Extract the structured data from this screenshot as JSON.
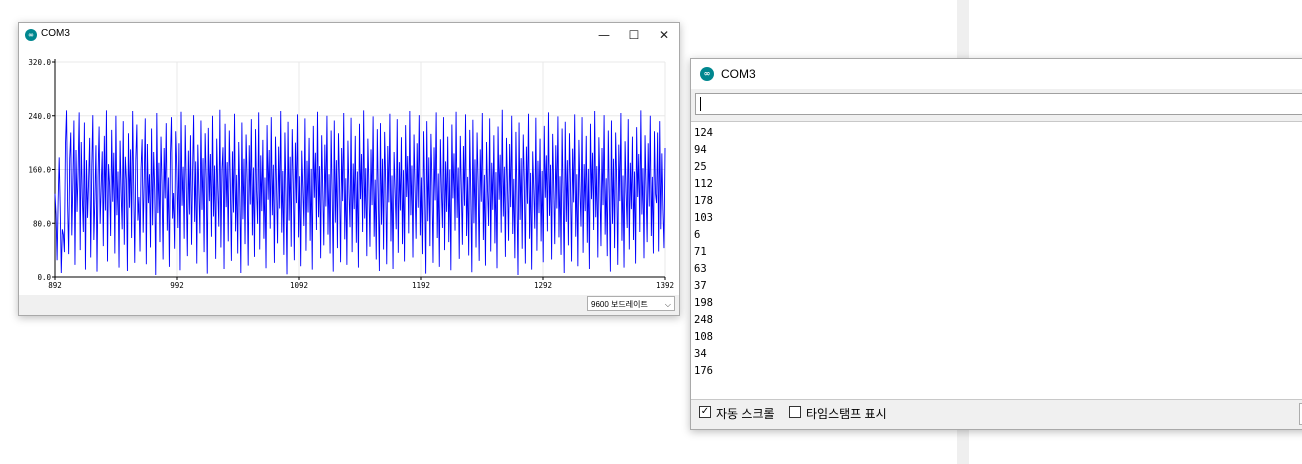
{
  "plotter_window": {
    "title": "COM3",
    "icon": "arduino-icon",
    "controls": {
      "minimize": "—",
      "maximize": "☐",
      "close": "✕"
    },
    "baud_select": {
      "value": "9600 보드레이트",
      "icon": "chevron-down-icon"
    }
  },
  "monitor_window": {
    "title": "COM3",
    "icon": "arduino-icon",
    "send_input": {
      "value": ""
    },
    "output_lines": [
      "124",
      "94",
      "25",
      "112",
      "178",
      "103",
      "6",
      "71",
      "63",
      "37",
      "198",
      "248",
      "108",
      "34",
      "176"
    ],
    "autoscroll": {
      "checked": true,
      "label": "자동 스크롤"
    },
    "timestamp": {
      "checked": false,
      "label": "타임스탬프 표시"
    }
  },
  "chart_data": {
    "type": "line",
    "title": "",
    "xlabel": "",
    "ylabel": "",
    "ylim": [
      0,
      320
    ],
    "xlim": [
      892,
      1392
    ],
    "y_ticks": [
      "0.0",
      "80.0",
      "160.0",
      "240.0",
      "320.0"
    ],
    "x_ticks": [
      "892",
      "992",
      "1092",
      "1192",
      "1292",
      "1392"
    ],
    "color": "#0000ff",
    "series": [
      {
        "values": [
          124,
          94,
          25,
          112,
          178,
          103,
          6,
          71,
          63,
          37,
          198,
          248,
          108,
          34,
          176,
          215,
          62,
          140,
          233,
          18,
          189,
          97,
          156,
          245,
          40,
          201,
          120,
          67,
          230,
          11,
          174,
          88,
          143,
          207,
          29,
          162,
          241,
          55,
          118,
          196,
          8,
          150,
          224,
          79,
          133,
          187,
          46,
          210,
          99,
          248,
          23,
          168,
          137,
          61,
          219,
          112,
          185,
          35,
          240,
          92,
          157,
          14,
          203,
          126,
          71,
          232,
          48,
          179,
          145,
          9,
          214,
          103,
          190,
          58,
          247,
          132,
          21,
          175,
          227,
          84,
          119,
          38,
          161,
          205,
          66,
          142,
          236,
          19,
          198,
          110,
          153,
          44,
          221,
          77,
          186,
          130,
          3,
          244,
          95,
          170,
          52,
          209,
          138,
          26,
          192,
          117,
          229,
          69,
          148,
          15,
          181,
          238,
          87,
          125,
          42,
          217,
          160,
          73,
          199,
          10,
          246,
          106,
          164,
          57,
          226,
          135,
          31,
          188,
          93,
          211,
          48,
          154,
          241,
          82,
          172,
          20,
          197,
          128,
          65,
          233,
          100,
          177,
          37,
          214,
          146,
          5,
          222,
          113,
          183,
          60,
          240,
          90,
          166,
          27,
          206,
          131,
          75,
          249,
          44,
          159,
          193,
          12,
          228,
          104,
          171,
          53,
          218,
          139,
          24,
          187,
          96,
          243,
          68,
          152,
          35,
          201,
          121,
          6,
          230,
          86,
          176,
          49,
          212,
          144,
          17,
          196,
          108,
          235,
          62,
          163,
          30,
          220,
          127,
          79,
          245,
          41,
          181,
          98,
          204,
          57,
          148,
          13,
          226,
          115,
          189,
          72,
          238,
          92,
          167,
          21,
          209,
          136,
          50,
          194,
          102,
          247,
          66,
          158,
          33,
          215,
          123,
          4,
          231,
          84,
          179,
          45,
          220,
          141,
          25,
          200,
          110,
          242,
          59,
          150,
          16,
          188,
          132,
          76,
          236,
          39,
          173,
          96,
          207,
          54,
          161,
          11,
          225,
          118,
          185,
          70,
          246,
          89,
          165,
          28,
          211,
          129,
          47,
          197,
          105,
          240,
          63,
          153,
          35,
          218,
          124,
          8,
          233,
          81,
          174,
          43,
          214,
          138,
          22,
          192,
          113,
          244,
          56,
          147,
          18,
          203,
          126,
          74,
          237,
          37,
          169,
          101,
          210,
          51,
          157,
          14,
          228,
          116,
          183,
          67,
          248,
          87,
          162,
          31,
          206,
          134,
          45,
          190,
          107,
          239,
          60,
          145,
          26,
          220,
          121,
          9,
          229,
          78,
          176,
          41,
          216,
          140,
          19,
          195,
          111,
          243,
          53,
          151,
          12,
          186,
          130,
          71,
          235,
          36,
          171,
          99,
          208,
          49,
          159,
          23,
          226,
          119,
          180,
          65,
          247,
          92,
          166,
          29,
          212,
          133,
          57,
          199,
          103,
          241,
          62,
          148,
          34,
          217,
          125,
          5,
          232,
          83,
          178,
          46,
          213,
          137,
          21,
          193,
          114,
          245,
          58,
          154,
          15,
          205,
          127,
          73,
          238,
          40,
          172,
          97,
          209,
          52,
          160,
          10,
          227,
          117,
          184,
          69,
          246,
          88,
          163,
          27,
          210,
          131,
          48,
          195,
          106,
          242,
          61,
          149,
          32,
          219,
          122,
          7,
          234,
          80,
          175,
          44,
          215,
          139,
          24,
          190,
          112,
          244,
          55,
          152,
          17,
          201,
          128,
          76,
          236,
          38,
          170,
          100,
          211,
          50,
          156,
          13,
          224,
          115,
          182,
          66,
          249,
          90,
          164,
          30,
          207,
          135,
          54,
          198,
          104,
          240,
          64,
          146,
          28,
          216,
          120,
          3,
          230,
          85,
          177,
          42,
          212,
          142,
          20,
          194,
          109,
          243,
          57,
          155,
          11,
          187,
          131,
          72,
          237,
          39,
          173,
          95,
          206,
          53,
          158,
          22,
          225,
          118,
          181,
          68,
          245,
          91,
          167,
          26,
          213,
          132,
          49,
          196,
          102,
          239,
          59,
          150,
          33,
          221,
          123,
          6,
          231,
          82,
          174,
          47,
          214,
          136,
          23,
          191,
          111,
          242,
          60,
          153,
          16,
          204,
          129,
          75,
          238,
          36,
          168,
          98,
          210,
          51,
          161,
          12,
          228,
          116,
          185,
          70,
          247,
          89,
          165,
          29,
          208,
          134,
          46,
          192,
          107,
          241,
          63,
          147,
          31,
          218,
          121,
          8,
          233,
          79,
          176,
          43,
          215,
          141,
          18,
          197,
          113,
          244,
          54,
          151,
          14,
          202,
          126,
          73,
          235,
          41,
          170,
          101,
          209,
          55,
          157,
          20,
          223,
          119,
          183,
          67,
          248,
          93,
          162,
          28,
          211,
          130,
          52,
          199,
          105,
          240,
          61,
          149,
          35,
          217,
          124,
          110,
          215,
          38,
          232,
          71,
          184,
          100,
          43,
          192
        ]
      }
    ]
  }
}
